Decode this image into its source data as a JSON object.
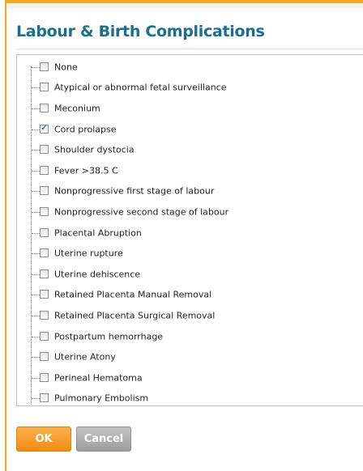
{
  "dialog": {
    "title": "Labour & Birth Complications"
  },
  "options": [
    {
      "label": "None",
      "checked": false
    },
    {
      "label": "Atypical or abnormal fetal surveillance",
      "checked": false
    },
    {
      "label": "Meconium",
      "checked": false
    },
    {
      "label": "Cord prolapse",
      "checked": true
    },
    {
      "label": "Shoulder dystocia",
      "checked": false
    },
    {
      "label": "Fever >38.5 C",
      "checked": false
    },
    {
      "label": "Nonprogressive first stage of labour",
      "checked": false
    },
    {
      "label": "Nonprogressive second stage of labour",
      "checked": false
    },
    {
      "label": "Placental Abruption",
      "checked": false
    },
    {
      "label": "Uterine rupture",
      "checked": false
    },
    {
      "label": "Uterine dehiscence",
      "checked": false
    },
    {
      "label": "Retained Placenta Manual Removal",
      "checked": false
    },
    {
      "label": "Retained Placenta Surgical Removal",
      "checked": false
    },
    {
      "label": "Postpartum hemorrhage",
      "checked": false
    },
    {
      "label": "Uterine Atony",
      "checked": false
    },
    {
      "label": "Perineal Hematoma",
      "checked": false
    },
    {
      "label": "Pulmonary Embolism",
      "checked": false
    }
  ],
  "buttons": {
    "ok_label": "OK",
    "cancel_label": "Cancel"
  },
  "colors": {
    "accent": "#f5a623",
    "title": "#1a6e8e",
    "ok_button": "#f39a1f",
    "cancel_button": "#a8a8a8"
  },
  "icons": {
    "checked": "checkbox-checked-icon",
    "unchecked": "checkbox-unchecked-icon"
  }
}
